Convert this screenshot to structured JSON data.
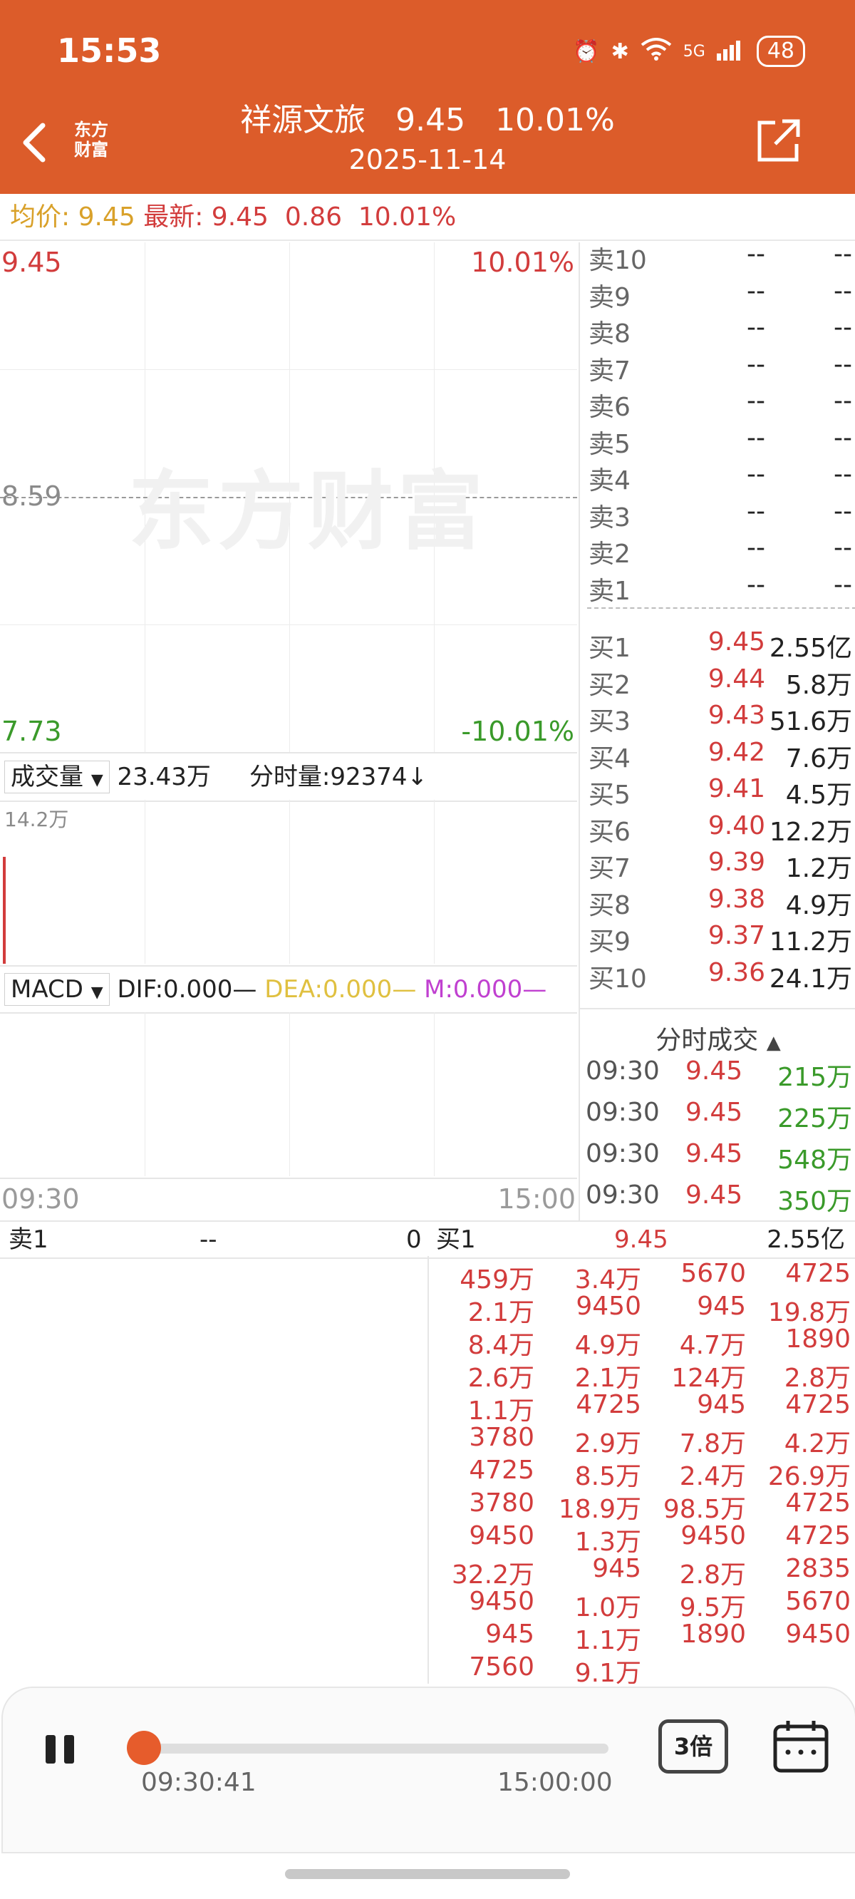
{
  "status_bar": {
    "time": "15:53",
    "battery": "48",
    "network": "5G"
  },
  "header": {
    "logo_line1": "东方",
    "logo_line2": "财富",
    "stock_name": "祥源文旅",
    "price": "9.45",
    "change_pct": "10.01%",
    "date": "2025-11-14"
  },
  "info_bar": {
    "avg_label": "均价:",
    "avg_value": "9.45",
    "latest_label": "最新:",
    "latest_value": "9.45",
    "change": "0.86",
    "change_pct": "10.01%"
  },
  "price_chart": {
    "top_price": "9.45",
    "top_pct": "10.01%",
    "mid_price": "8.59",
    "bottom_price": "7.73",
    "bottom_pct": "-10.01%",
    "watermark": "东方财富"
  },
  "volume": {
    "indicator": "成交量",
    "total": "23.43万",
    "tick_label": "分时量:92374↓",
    "max_label": "14.2万"
  },
  "macd": {
    "indicator": "MACD",
    "dif": "DIF:0.000—",
    "dea": "DEA:0.000—",
    "m": "M:0.000—"
  },
  "time_axis": {
    "start": "09:30",
    "end": "15:00"
  },
  "order_book": {
    "asks": [
      {
        "label": "卖10",
        "price": "--",
        "volume": "--"
      },
      {
        "label": "卖9",
        "price": "--",
        "volume": "--"
      },
      {
        "label": "卖8",
        "price": "--",
        "volume": "--"
      },
      {
        "label": "卖7",
        "price": "--",
        "volume": "--"
      },
      {
        "label": "卖6",
        "price": "--",
        "volume": "--"
      },
      {
        "label": "卖5",
        "price": "--",
        "volume": "--"
      },
      {
        "label": "卖4",
        "price": "--",
        "volume": "--"
      },
      {
        "label": "卖3",
        "price": "--",
        "volume": "--"
      },
      {
        "label": "卖2",
        "price": "--",
        "volume": "--"
      },
      {
        "label": "卖1",
        "price": "--",
        "volume": "--"
      }
    ],
    "bids": [
      {
        "label": "买1",
        "price": "9.45",
        "volume": "2.55亿"
      },
      {
        "label": "买2",
        "price": "9.44",
        "volume": "5.8万"
      },
      {
        "label": "买3",
        "price": "9.43",
        "volume": "51.6万"
      },
      {
        "label": "买4",
        "price": "9.42",
        "volume": "7.6万"
      },
      {
        "label": "买5",
        "price": "9.41",
        "volume": "4.5万"
      },
      {
        "label": "买6",
        "price": "9.40",
        "volume": "12.2万"
      },
      {
        "label": "买7",
        "price": "9.39",
        "volume": "1.2万"
      },
      {
        "label": "买8",
        "price": "9.38",
        "volume": "4.9万"
      },
      {
        "label": "买9",
        "price": "9.37",
        "volume": "11.2万"
      },
      {
        "label": "买10",
        "price": "9.36",
        "volume": "24.1万"
      }
    ]
  },
  "ticks": {
    "title": "分时成交",
    "rows": [
      {
        "time": "09:30",
        "price": "9.45",
        "amount": "215万"
      },
      {
        "time": "09:30",
        "price": "9.45",
        "amount": "225万"
      },
      {
        "time": "09:30",
        "price": "9.45",
        "amount": "548万"
      },
      {
        "time": "09:30",
        "price": "9.45",
        "amount": "350万"
      }
    ]
  },
  "queue": {
    "sell_label": "卖1",
    "sell_price": "--",
    "sell_count": "0",
    "buy_label": "买1",
    "buy_price": "9.45",
    "buy_volume": "2.55亿",
    "orders": [
      [
        "459万",
        "3.4万",
        "5670",
        "4725"
      ],
      [
        "2.1万",
        "9450",
        "945",
        "19.8万"
      ],
      [
        "8.4万",
        "4.9万",
        "4.7万",
        "1890"
      ],
      [
        "2.6万",
        "2.1万",
        "124万",
        "2.8万"
      ],
      [
        "1.1万",
        "4725",
        "945",
        "4725"
      ],
      [
        "3780",
        "2.9万",
        "7.8万",
        "4.2万"
      ],
      [
        "4725",
        "8.5万",
        "2.4万",
        "26.9万"
      ],
      [
        "3780",
        "18.9万",
        "98.5万",
        "4725"
      ],
      [
        "9450",
        "1.3万",
        "9450",
        "4725"
      ],
      [
        "32.2万",
        "945",
        "2.8万",
        "2835"
      ],
      [
        "9450",
        "1.0万",
        "9.5万",
        "5670"
      ],
      [
        "945",
        "1.1万",
        "1890",
        "9450"
      ],
      [
        "7560",
        "9.1万",
        "",
        ""
      ]
    ]
  },
  "player": {
    "current_time": "09:30:41",
    "end_time": "15:00:00",
    "speed": "3倍",
    "progress": 0.0
  },
  "colors": {
    "brand": "#dc5c2a",
    "up": "#d23c3c",
    "down": "#3a9a2a",
    "dea": "#e0c040",
    "m": "#c040d0"
  }
}
